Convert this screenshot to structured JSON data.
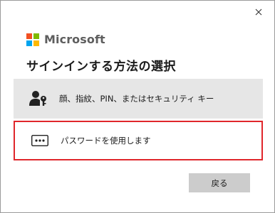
{
  "dialog": {
    "brand": "Microsoft",
    "title": "サインインする方法の選択",
    "logo_colors": [
      "#f25022",
      "#7fba00",
      "#00a4ef",
      "#ffb900"
    ]
  },
  "options": [
    {
      "label": "顔、指紋、PIN、またはセキュリティ キー",
      "icon": "person-key-icon"
    },
    {
      "label": "パスワードを使用します",
      "icon": "password-dots-icon"
    }
  ],
  "buttons": {
    "back_label": "戻る",
    "close_icon": "close-icon"
  },
  "colors": {
    "highlight_border": "#e0262b",
    "option_bg": "#e6e6e6",
    "button_bg": "#cccccc"
  }
}
